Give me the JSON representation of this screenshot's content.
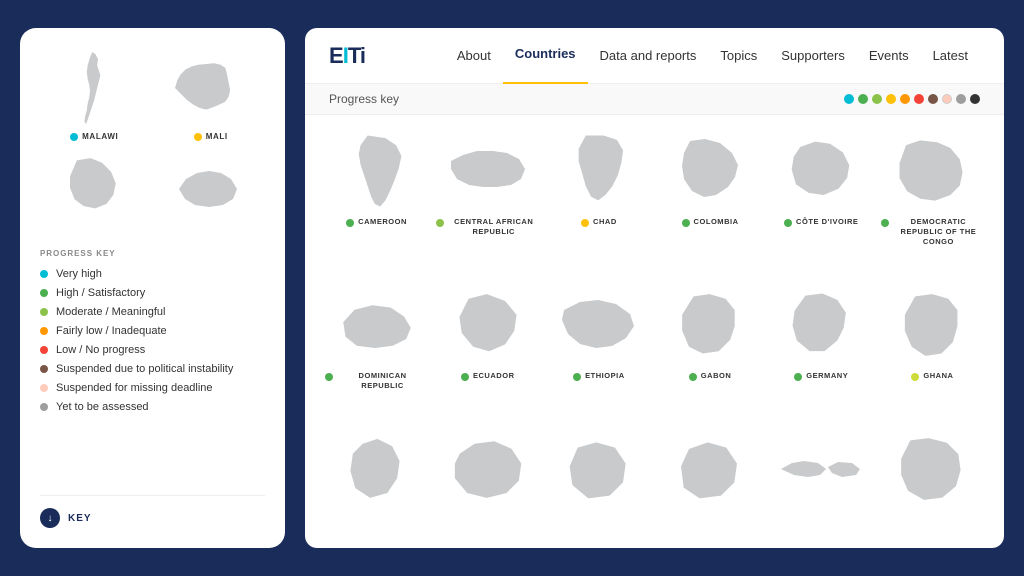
{
  "leftCard": {
    "mapPreviews": [
      {
        "country": "MALAWI",
        "dotClass": "dot-cyan"
      },
      {
        "country": "MALI",
        "dotClass": "dot-yellow"
      }
    ],
    "progressKeyTitle": "PROGRESS KEY",
    "keyItems": [
      {
        "label": "Very high",
        "dotClass": "dot-cyan"
      },
      {
        "label": "High / Satisfactory",
        "dotClass": "dot-green"
      },
      {
        "label": "Moderate / Meaningful",
        "dotClass": "dot-olive"
      },
      {
        "label": "Fairly low / Inadequate",
        "dotClass": "dot-orange"
      },
      {
        "label": "Low / No progress",
        "dotClass": "dot-red"
      },
      {
        "label": "Suspended due to political instability",
        "dotClass": "dot-brown"
      },
      {
        "label": "Suspended for missing deadline",
        "dotClass": "dot-peach"
      },
      {
        "label": "Yet to be assessed",
        "dotClass": "dot-gray"
      }
    ],
    "footerLabel": "KEY"
  },
  "nav": {
    "logo": "EITi",
    "links": [
      {
        "label": "About",
        "active": false
      },
      {
        "label": "Countries",
        "active": true
      },
      {
        "label": "Data and reports",
        "active": false
      },
      {
        "label": "Topics",
        "active": false
      },
      {
        "label": "Supporters",
        "active": false
      },
      {
        "label": "Events",
        "active": false
      },
      {
        "label": "Latest",
        "active": false
      }
    ]
  },
  "progressKey": {
    "label": "Progress key",
    "dots": [
      "#00bcd4",
      "#4caf50",
      "#8bc34a",
      "#ff9800",
      "#f44336",
      "#795548",
      "#ffccbc",
      "#9e9e9e",
      "#333",
      "#ffc107"
    ]
  },
  "countries": [
    {
      "name": "CAMEROON",
      "dotClass": "dot-green"
    },
    {
      "name": "CENTRAL AFRICAN REPUBLIC",
      "dotClass": "dot-olive"
    },
    {
      "name": "CHAD",
      "dotClass": "dot-yellow"
    },
    {
      "name": "COLOMBIA",
      "dotClass": "dot-green"
    },
    {
      "name": "CÔTE D'IVOIRE",
      "dotClass": "dot-green"
    },
    {
      "name": "DEMOCRATIC REPUBLIC OF THE CONGO",
      "dotClass": "dot-green"
    },
    {
      "name": "DOMINICAN REPUBLIC",
      "dotClass": "dot-green"
    },
    {
      "name": "ECUADOR",
      "dotClass": "dot-green"
    },
    {
      "name": "ETHIOPIA",
      "dotClass": "dot-green"
    },
    {
      "name": "GABON",
      "dotClass": "dot-green"
    },
    {
      "name": "GERMANY",
      "dotClass": "dot-green"
    },
    {
      "name": "GHANA",
      "dotClass": "dot-lime"
    },
    {
      "name": "",
      "dotClass": "dot-green"
    },
    {
      "name": "",
      "dotClass": "dot-green"
    },
    {
      "name": "",
      "dotClass": "dot-green"
    },
    {
      "name": "",
      "dotClass": "dot-green"
    },
    {
      "name": "",
      "dotClass": "dot-green"
    },
    {
      "name": "",
      "dotClass": "dot-green"
    }
  ]
}
